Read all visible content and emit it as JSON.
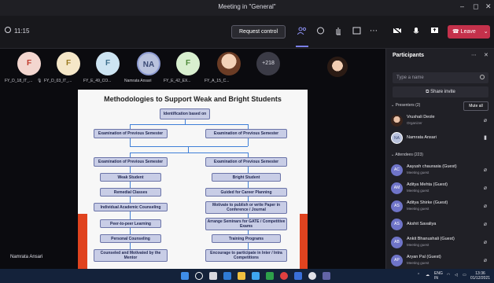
{
  "window": {
    "title": "Meeting in \"General\"",
    "controls": [
      "–",
      "◻",
      "✕"
    ]
  },
  "toolbar": {
    "timer": "11:15",
    "request_control": "Request control",
    "leave": "Leave",
    "icons": [
      "people-icon",
      "chat-icon",
      "raise-hand-icon",
      "rooms-icon",
      "more-icon",
      "camera-off-icon",
      "mic-icon",
      "share-icon"
    ]
  },
  "participants_strip": [
    {
      "initial": "F",
      "name": "FY_D_18_IT_..."
    },
    {
      "initial": "F",
      "name": "FY_D_03_IT_..."
    },
    {
      "initial": "F",
      "name": "FY_E_49_CO..."
    },
    {
      "initial": "NA",
      "name": "Namrata Ansari"
    },
    {
      "initial": "F",
      "name": "FY_E_42_EX..."
    },
    {
      "initial": "",
      "name": "FY_A_15_C..."
    },
    {
      "initial": "+218",
      "name": ""
    }
  ],
  "slide": {
    "title": "Methodologies to Support Weak and Bright Students",
    "boxes": {
      "identification": "Identification based on",
      "exam_left_1": "Examination of Previous Semester",
      "exam_right_1": "Examination of Previous Semester",
      "exam_left_2": "Examination of Previous Semester",
      "exam_right_2": "Examination of Previous Semester",
      "weak": "Weak Student",
      "bright": "Bright Student",
      "remedial": "Remedial Classes",
      "career": "Guided for Career Planning",
      "counseling": "Individual Academic Counseling",
      "publish": "Motivate to publish or write Paper in Conference / Journal",
      "peer": "Peer-to-peer Learning",
      "seminars": "Arrange Seminars for GATE / Competitive Exams",
      "personal": "Personal Counseling",
      "training": "Training Programs",
      "mentor": "Counseled and Motivated by the Mentor",
      "competition": "Encourage to participate in Inter / Intra Competitions"
    },
    "presenter": "Namrata Ansari"
  },
  "panel": {
    "title": "Participants",
    "search_placeholder": "Type a name",
    "share_invite": "Share invite",
    "presenters_label": "Presenters (2)",
    "mute_all": "Mute all",
    "attendees_label": "Attendees (223)",
    "presenters": [
      {
        "name": "Vrushali Deole",
        "role": "Organizer"
      },
      {
        "name": "Namrata Ansari",
        "role": ""
      }
    ],
    "attendees": [
      {
        "initials": "AC",
        "name": "Aayush chaurasia (Guest)",
        "role": "Meeting guest"
      },
      {
        "initials": "AM",
        "name": "Aditya Mehta (Guest)",
        "role": "Meeting guest"
      },
      {
        "initials": "AS",
        "name": "Aditya Shirke (Guest)",
        "role": "Meeting guest"
      },
      {
        "initials": "AS",
        "name": "Akshit Savaliya",
        "role": ""
      },
      {
        "initials": "AB",
        "name": "Ankit Bhanushali (Guest)",
        "role": "Meeting guest"
      },
      {
        "initials": "AP",
        "name": "Aryan Pal (Guest)",
        "role": "Meeting guest"
      }
    ]
  },
  "taskbar": {
    "lang": "ENG",
    "lang2": "IN",
    "time": "13:36",
    "date": "01/12/2021"
  }
}
